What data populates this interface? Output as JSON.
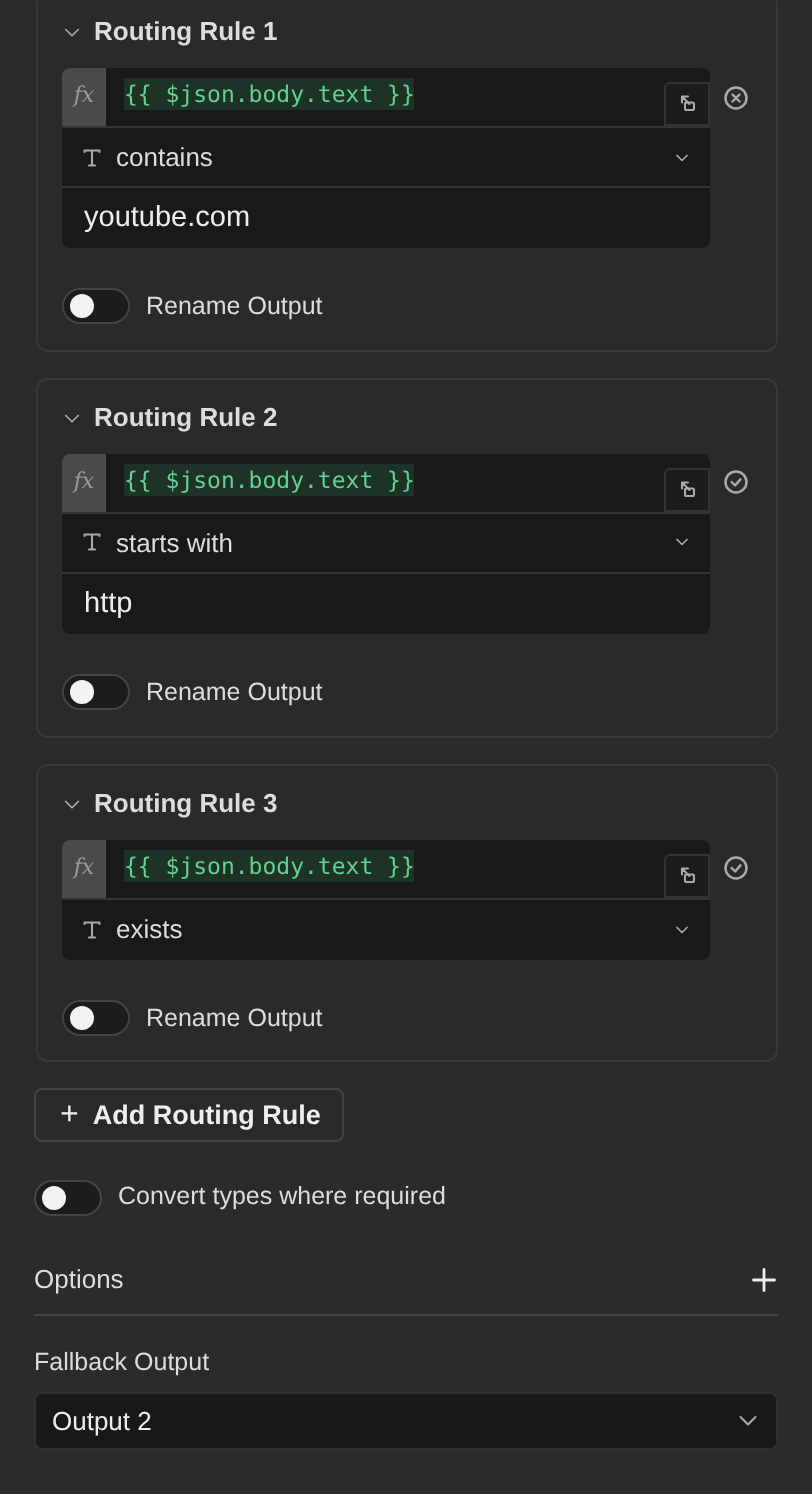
{
  "rules": [
    {
      "title": "Routing Rule 1",
      "expanded": true,
      "hovered": true,
      "fx_icon": "fx",
      "expression": "{{ $json.body.text }}",
      "operator": "contains",
      "value": "youtube.com",
      "rename_output": {
        "label": "Rename Output",
        "on": false
      }
    },
    {
      "title": "Routing Rule 2",
      "expanded": true,
      "hovered": false,
      "fx_icon": "fx",
      "expression": "{{ $json.body.text }}",
      "operator": "starts with",
      "value": "http",
      "rename_output": {
        "label": "Rename Output",
        "on": false
      }
    },
    {
      "title": "Routing Rule 3",
      "expanded": true,
      "hovered": false,
      "fx_icon": "fx",
      "expression": "{{ $json.body.text }}",
      "operator": "exists",
      "rename_output": {
        "label": "Rename Output",
        "on": false
      }
    }
  ],
  "add_button": {
    "icon": "+",
    "label": "Add Routing Rule"
  },
  "convert_types": {
    "label": "Convert types where required",
    "on": false
  },
  "options": {
    "label": "Options"
  },
  "fallback": {
    "label": "Fallback Output",
    "value": "Output 2"
  }
}
